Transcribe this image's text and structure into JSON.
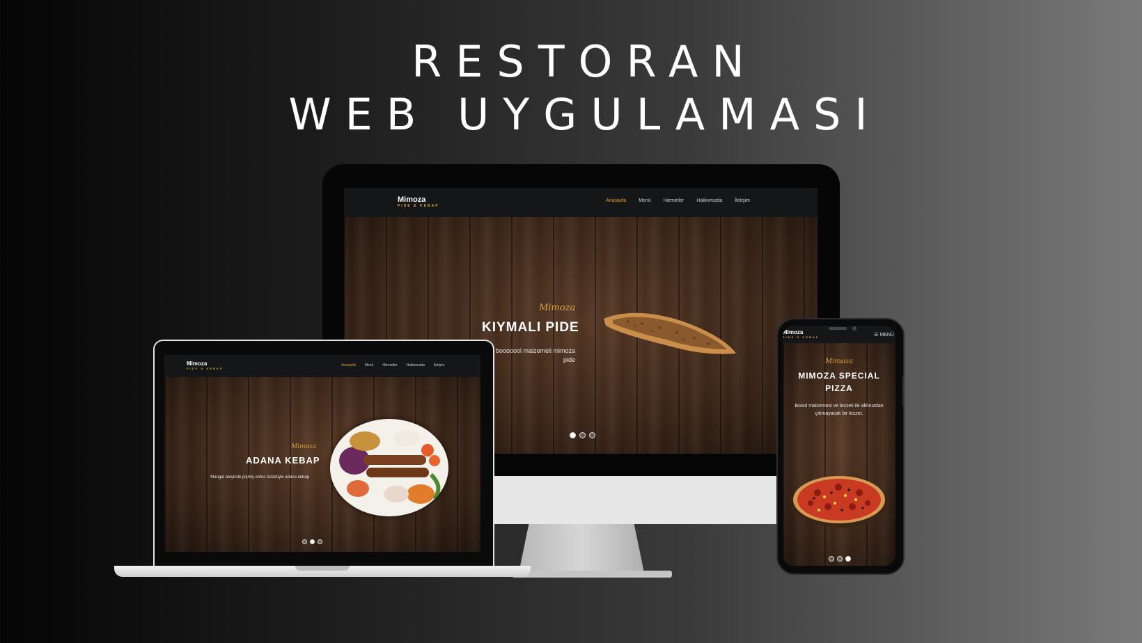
{
  "headline": {
    "line1": "RESTORAN",
    "line2": "WEB UYGULAMASI"
  },
  "brand": {
    "name": "Mimoza",
    "tagline": "PIDE & KEBAP"
  },
  "nav": {
    "items": [
      "Anasayfa",
      "Menü",
      "Hizmetler",
      "Hakkımızda",
      "İletişim"
    ],
    "active": "Anasayfa"
  },
  "desktop": {
    "script": "Mimoza",
    "title": "KIYMALI PIDE",
    "description": "o booooool malzemeli mimoza pide",
    "slides": 3,
    "active_slide": 1
  },
  "laptop": {
    "script": "Mimoza",
    "title": "ADANA KEBAP",
    "description": "Mangal ateşinde pişmiş enfes lezzetiyle adana kebap",
    "slides": 3,
    "active_slide": 2
  },
  "phone": {
    "menu_label": "MENÜ",
    "script": "Mimoza",
    "title": "MIMOZA SPECIAL PIZZA",
    "description": "Boool malzemesi ve lezzeti ile aklınızdan çıkmayacak bir lezzet.",
    "slides": 3,
    "active_slide": 3
  },
  "colors": {
    "accent": "#d9a441",
    "nav_bg": "#151617"
  },
  "icons": {
    "menu": "hamburger-icon"
  }
}
